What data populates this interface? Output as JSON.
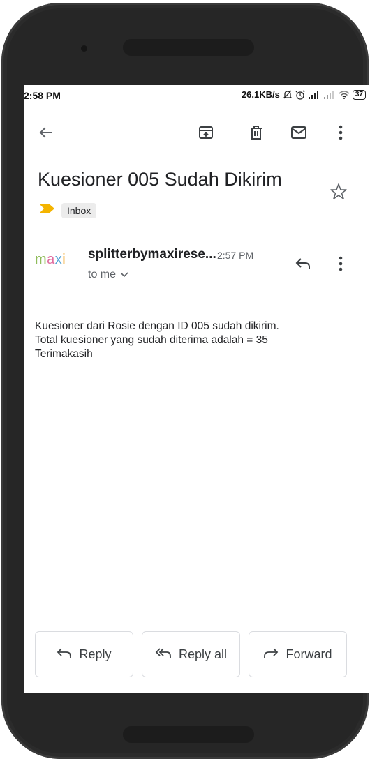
{
  "status_bar": {
    "time": "2:58 PM",
    "network_speed": "26.1KB/s",
    "battery": "37"
  },
  "toolbar": {
    "back_icon": "arrow-left-icon",
    "archive_icon": "archive-icon",
    "delete_icon": "trash-icon",
    "mark_unread_icon": "mail-icon",
    "more_icon": "more-vert-icon"
  },
  "email": {
    "subject": "Kuesioner 005 Sudah Dikirim",
    "label": "Inbox",
    "sender_avatar_text": "maxi",
    "sender": "splitterbymaxirese...",
    "time": "2:57 PM",
    "recipient": "to me",
    "body_lines": [
      "Kuesioner dari Rosie dengan ID 005 sudah dikirim.",
      "Total kuesioner yang sudah diterima adalah = 35",
      "Terimakasih"
    ]
  },
  "actions": {
    "reply": "Reply",
    "reply_all": "Reply all",
    "forward": "Forward"
  },
  "colors": {
    "text": "#202124",
    "secondary": "#5f6368",
    "important_marker": "#f4b400",
    "phone_frame": "#2b2b2b"
  }
}
